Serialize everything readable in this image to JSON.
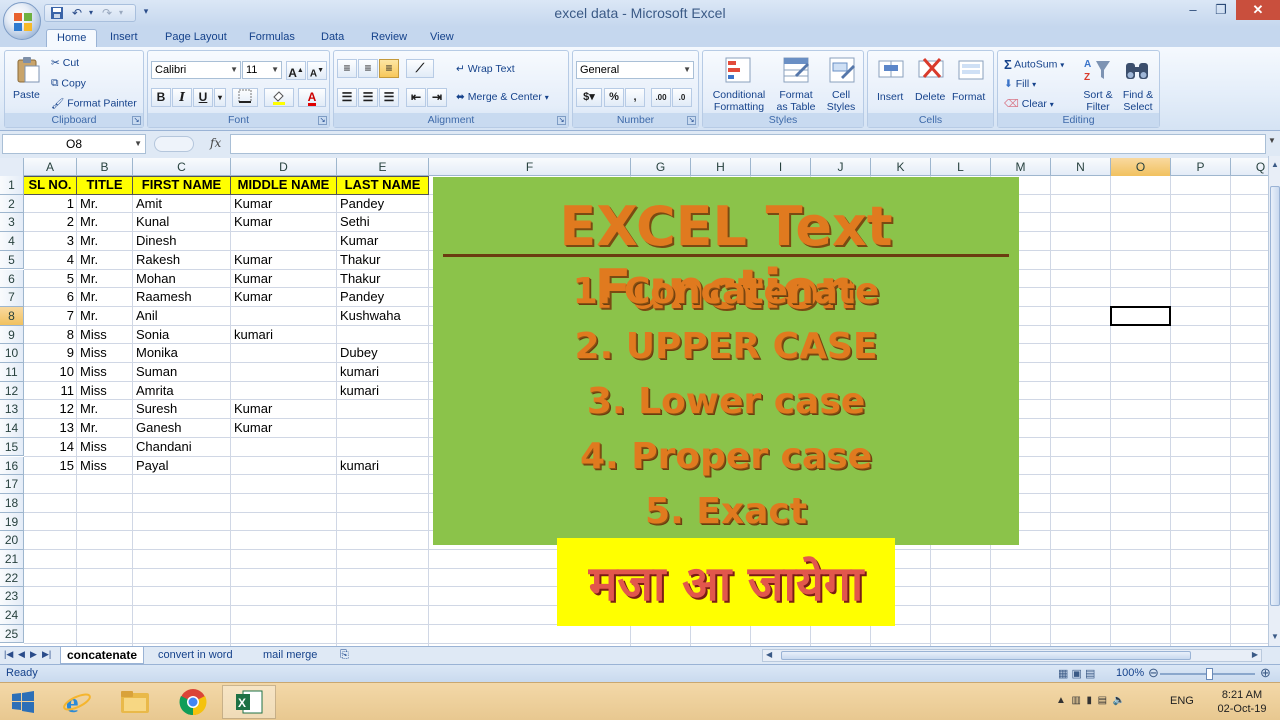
{
  "window": {
    "title": "excel data - Microsoft Excel"
  },
  "tabs": [
    "Home",
    "Insert",
    "Page Layout",
    "Formulas",
    "Data",
    "Review",
    "View"
  ],
  "ribbon": {
    "clipboard": {
      "label": "Clipboard",
      "paste": "Paste",
      "cut": "Cut",
      "copy": "Copy",
      "format_painter": "Format Painter"
    },
    "font": {
      "label": "Font",
      "font_name": "Calibri",
      "font_size": "11"
    },
    "alignment": {
      "label": "Alignment",
      "wrap_text": "Wrap Text",
      "merge_center": "Merge & Center"
    },
    "number": {
      "label": "Number",
      "format": "General"
    },
    "styles": {
      "label": "Styles",
      "conditional": [
        "Conditional",
        "Formatting"
      ],
      "format_table": [
        "Format",
        "as Table"
      ],
      "cell_styles": [
        "Cell",
        "Styles"
      ]
    },
    "cells": {
      "label": "Cells",
      "insert": "Insert",
      "delete": "Delete",
      "format": "Format"
    },
    "editing": {
      "label": "Editing",
      "autosum": "AutoSum",
      "fill": "Fill",
      "clear": "Clear",
      "sort_filter": [
        "Sort &",
        "Filter"
      ],
      "find_select": [
        "Find &",
        "Select"
      ]
    }
  },
  "formula_bar": {
    "name_box": "O8",
    "fx": "fx",
    "value": ""
  },
  "columns": [
    "A",
    "B",
    "C",
    "D",
    "E",
    "F",
    "G",
    "H",
    "I",
    "J",
    "K",
    "L",
    "M",
    "N",
    "O",
    "P",
    "Q"
  ],
  "rows": [
    "1",
    "2",
    "3",
    "4",
    "5",
    "6",
    "7",
    "8",
    "9",
    "10",
    "11",
    "12",
    "13",
    "14",
    "15",
    "16",
    "17",
    "18",
    "19",
    "20",
    "21",
    "22",
    "23",
    "24",
    "25"
  ],
  "table": {
    "headers": [
      "SL NO.",
      "TITLE",
      "FIRST NAME",
      "MIDDLE NAME",
      "LAST NAME"
    ],
    "rows": [
      [
        "1",
        "Mr.",
        "Amit",
        "Kumar",
        "Pandey"
      ],
      [
        "2",
        "Mr.",
        "Kunal",
        "Kumar",
        "Sethi"
      ],
      [
        "3",
        "Mr.",
        "Dinesh",
        "",
        "Kumar"
      ],
      [
        "4",
        "Mr.",
        "Rakesh",
        "Kumar",
        "Thakur"
      ],
      [
        "5",
        "Mr.",
        "Mohan",
        "Kumar",
        "Thakur"
      ],
      [
        "6",
        "Mr.",
        "Raamesh",
        "Kumar",
        "Pandey"
      ],
      [
        "7",
        "Mr.",
        "Anil",
        "",
        "Kushwaha"
      ],
      [
        "8",
        "Miss",
        "Sonia",
        "kumari",
        ""
      ],
      [
        "9",
        "Miss",
        "Monika",
        "",
        "Dubey"
      ],
      [
        "10",
        "Miss",
        "Suman",
        "",
        "kumari"
      ],
      [
        "11",
        "Miss",
        "Amrita",
        "",
        "kumari"
      ],
      [
        "12",
        "Mr.",
        "Suresh",
        "Kumar",
        ""
      ],
      [
        "13",
        "Mr.",
        "Ganesh",
        "Kumar",
        ""
      ],
      [
        "14",
        "Miss",
        "Chandani",
        "",
        ""
      ],
      [
        "15",
        "Miss",
        "Payal",
        "",
        "kumari"
      ]
    ]
  },
  "banner": {
    "title": "EXCEL Text Function",
    "items": [
      "1. Concatenate",
      "2. UPPER CASE",
      "3. Lower case",
      "4. Proper case",
      "5. Exact"
    ],
    "hindi": "मजा आ जायेगा"
  },
  "sheets": [
    "concatenate",
    "convert in word",
    "mail merge"
  ],
  "status": {
    "text": "Ready",
    "zoom": "100%"
  },
  "taskbar": {
    "lang": "ENG",
    "time": "8:21 AM",
    "date": "02-Oct-19"
  },
  "colors": {
    "header_yellow": "#ffff00",
    "banner_green": "#8bc34a",
    "banner_orange": "#e07a1f",
    "hindi_red": "#e2574c"
  }
}
